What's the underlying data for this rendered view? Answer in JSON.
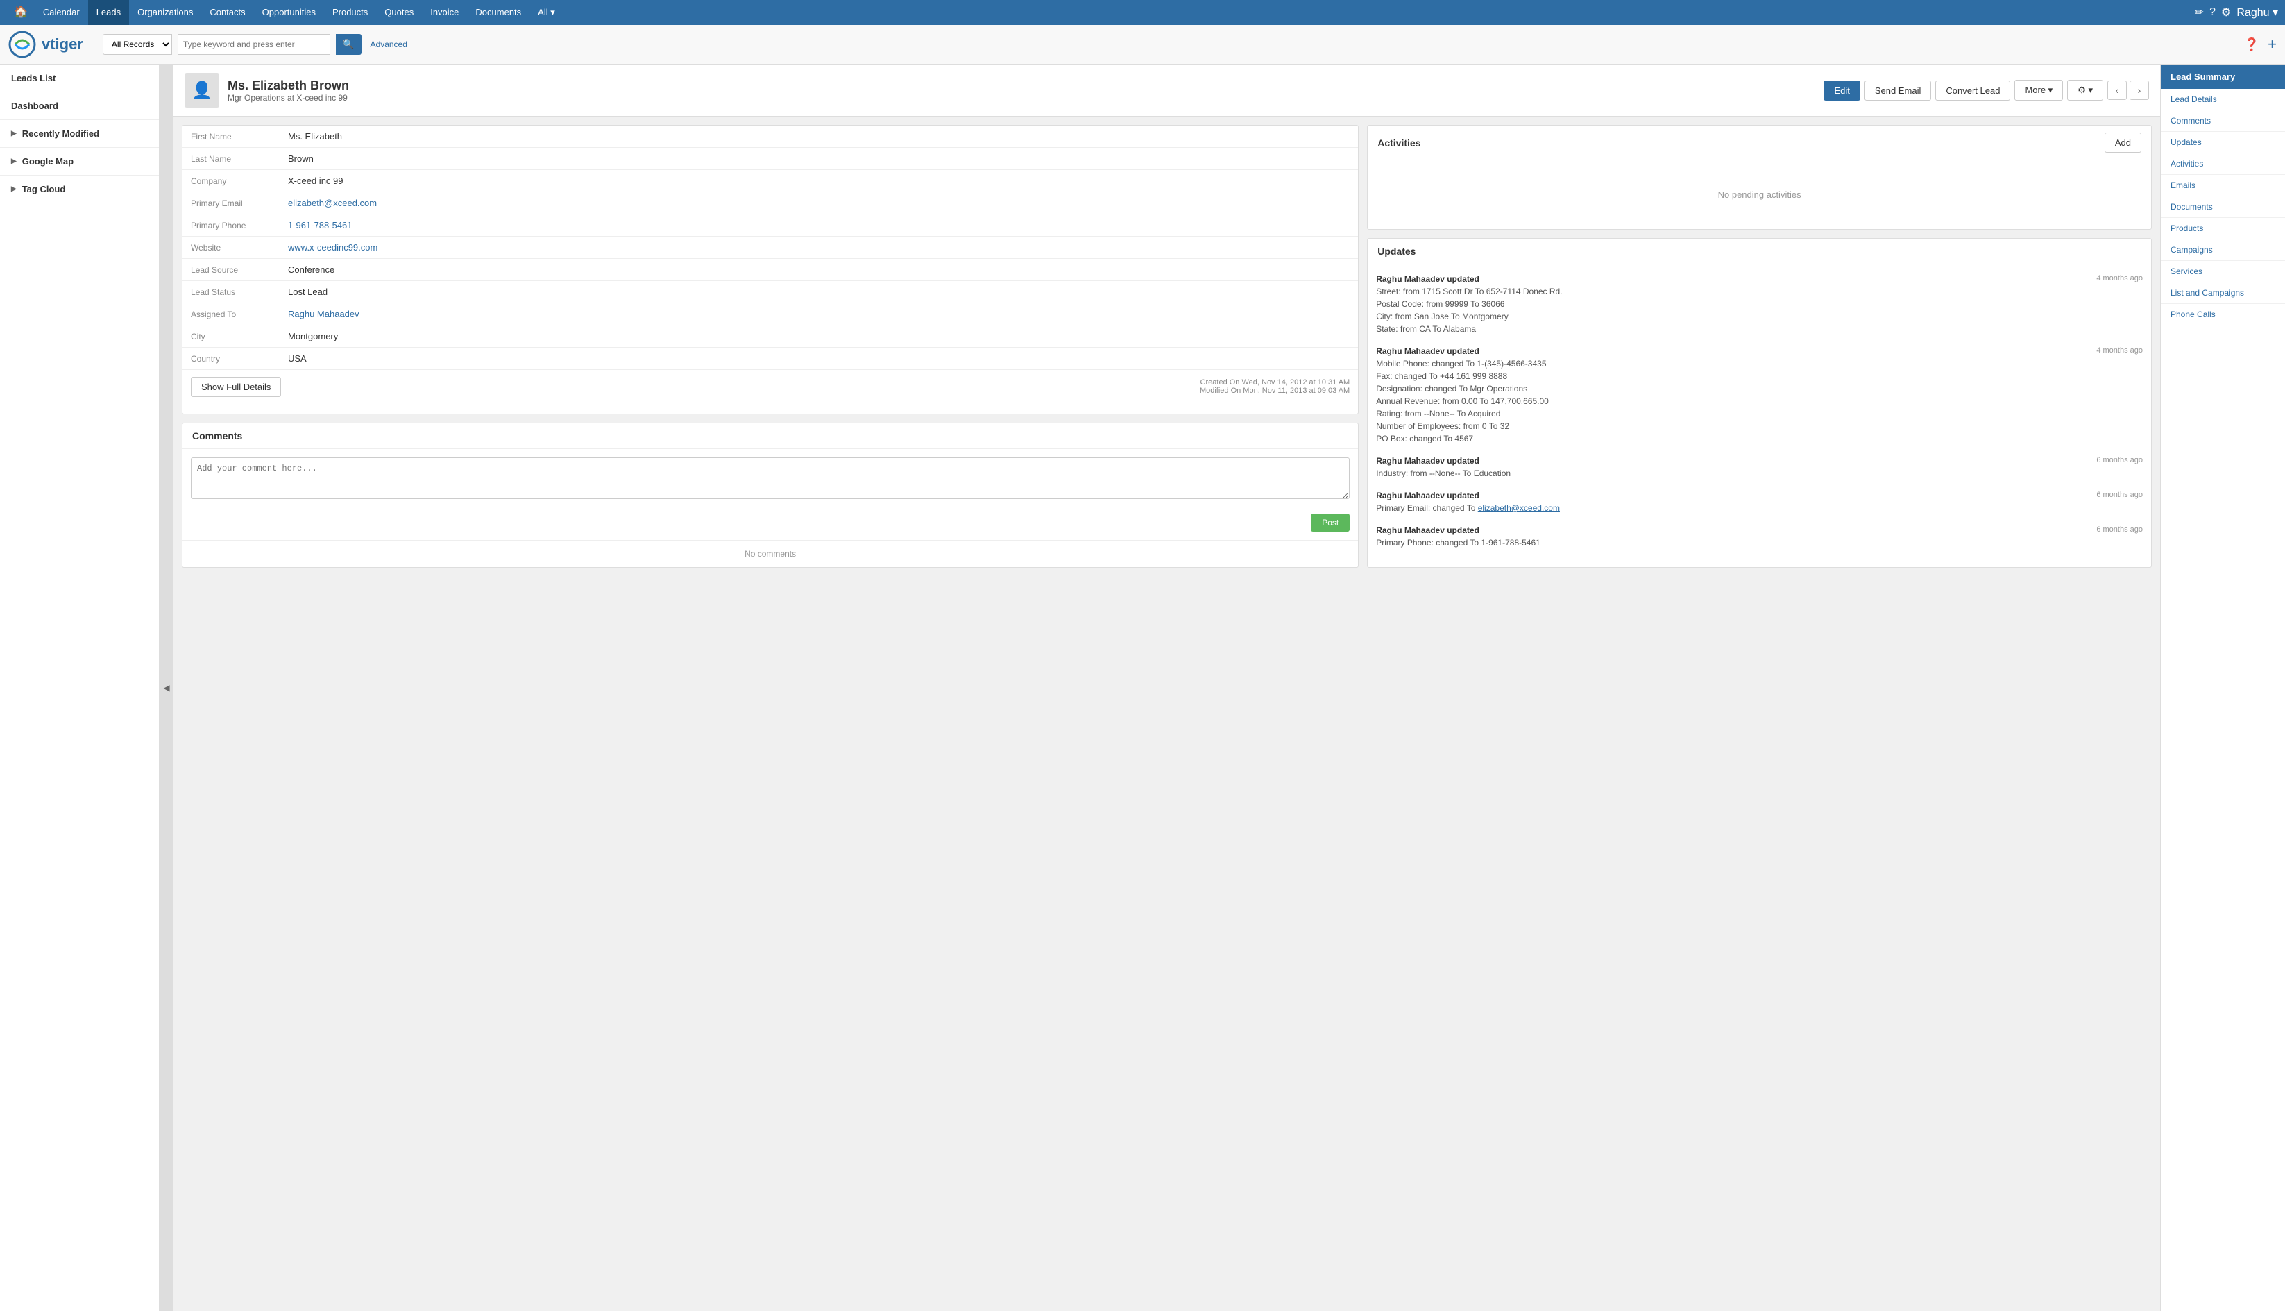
{
  "app": {
    "title": "vtiger"
  },
  "topnav": {
    "items": [
      {
        "label": "Home",
        "id": "home",
        "active": false
      },
      {
        "label": "Calendar",
        "id": "calendar",
        "active": false
      },
      {
        "label": "Leads",
        "id": "leads",
        "active": true
      },
      {
        "label": "Organizations",
        "id": "organizations",
        "active": false
      },
      {
        "label": "Contacts",
        "id": "contacts",
        "active": false
      },
      {
        "label": "Opportunities",
        "id": "opportunities",
        "active": false
      },
      {
        "label": "Products",
        "id": "products",
        "active": false
      },
      {
        "label": "Quotes",
        "id": "quotes",
        "active": false
      },
      {
        "label": "Invoice",
        "id": "invoice",
        "active": false
      },
      {
        "label": "Documents",
        "id": "documents",
        "active": false
      },
      {
        "label": "All ▾",
        "id": "all",
        "active": false
      }
    ],
    "right_icons": [
      "✏",
      "?",
      "⚙"
    ],
    "username": "Raghu ▾"
  },
  "search": {
    "dropdown_value": "All Records",
    "placeholder": "Type keyword and press enter",
    "advanced_label": "Advanced"
  },
  "sidebar": {
    "items": [
      {
        "label": "Leads List",
        "id": "leads-list",
        "has_arrow": false
      },
      {
        "label": "Dashboard",
        "id": "dashboard",
        "has_arrow": false
      },
      {
        "label": "Recently Modified",
        "id": "recently-modified",
        "has_arrow": true
      },
      {
        "label": "Google Map",
        "id": "google-map",
        "has_arrow": true
      },
      {
        "label": "Tag Cloud",
        "id": "tag-cloud",
        "has_arrow": true
      }
    ]
  },
  "record": {
    "name": "Ms. Elizabeth Brown",
    "subtitle": "Mgr Operations at X-ceed inc 99",
    "actions": {
      "edit": "Edit",
      "send_email": "Send Email",
      "convert_lead": "Convert Lead",
      "more": "More ▾",
      "wrench": "⚙ ▾"
    }
  },
  "details": {
    "fields": [
      {
        "label": "First Name",
        "value": "Ms. Elizabeth",
        "type": "text"
      },
      {
        "label": "Last Name",
        "value": "Brown",
        "type": "text"
      },
      {
        "label": "Company",
        "value": "X-ceed inc 99",
        "type": "text"
      },
      {
        "label": "Primary Email",
        "value": "elizabeth@xceed.com",
        "type": "link"
      },
      {
        "label": "Primary Phone",
        "value": "1-961-788-5461",
        "type": "link"
      },
      {
        "label": "Website",
        "value": "www.x-ceedinc99.com",
        "type": "link"
      },
      {
        "label": "Lead Source",
        "value": "Conference",
        "type": "text"
      },
      {
        "label": "Lead Status",
        "value": "Lost Lead",
        "type": "text"
      },
      {
        "label": "Assigned To",
        "value": "Raghu Mahaadev",
        "type": "link"
      },
      {
        "label": "City",
        "value": "Montgomery",
        "type": "text"
      },
      {
        "label": "Country",
        "value": "USA",
        "type": "text"
      }
    ],
    "show_full_details": "Show Full Details",
    "created_on": "Created On Wed, Nov 14, 2012 at 10:31 AM",
    "modified_on": "Modified On Mon, Nov 11, 2013 at 09:03 AM"
  },
  "activities": {
    "title": "Activities",
    "add_btn": "Add",
    "no_activities": "No pending activities"
  },
  "updates": {
    "title": "Updates",
    "entries": [
      {
        "updater": "Raghu Mahaadev",
        "action": "updated",
        "time": "4 months ago",
        "details": [
          "Street: from 1715 Scott Dr To 652-7114 Donec Rd.",
          "Postal Code: from 99999 To 36066",
          "City: from San Jose To Montgomery",
          "State: from CA To Alabama"
        ]
      },
      {
        "updater": "Raghu Mahaadev",
        "action": "updated",
        "time": "4 months ago",
        "details": [
          "Mobile Phone: changed To 1-(345)-4566-3435",
          "Fax: changed To +44 161 999 8888",
          "Designation: changed To Mgr Operations",
          "Annual Revenue: from 0.00 To 147,700,665.00",
          "Rating: from --None-- To Acquired",
          "Number of Employees: from 0 To 32",
          "PO Box: changed To 4567"
        ]
      },
      {
        "updater": "Raghu Mahaadev",
        "action": "updated",
        "time": "6 months ago",
        "details": [
          "Industry: from --None-- To Education"
        ]
      },
      {
        "updater": "Raghu Mahaadev",
        "action": "updated",
        "time": "6 months ago",
        "details": [
          "Primary Email: changed To elizabeth@xceed.com"
        ]
      },
      {
        "updater": "Raghu Mahaadev",
        "action": "updated",
        "time": "6 months ago",
        "details": [
          "Primary Phone: changed To 1-961-788-5461"
        ]
      }
    ]
  },
  "right_sidebar": {
    "header": "Lead Summary",
    "items": [
      "Lead Details",
      "Comments",
      "Updates",
      "Activities",
      "Emails",
      "Documents",
      "Products",
      "Campaigns",
      "Services",
      "List and Campaigns",
      "Phone Calls"
    ]
  },
  "comments": {
    "title": "Comments",
    "placeholder": "Add your comment here...",
    "post_btn": "Post",
    "no_comments": "No comments"
  }
}
